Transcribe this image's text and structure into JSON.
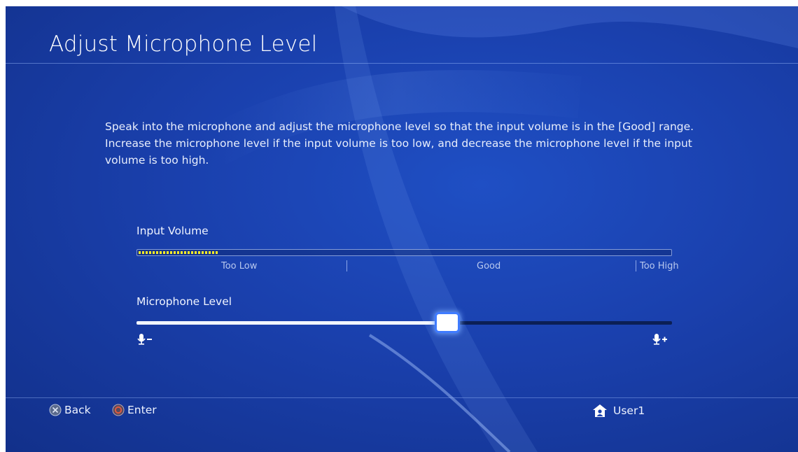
{
  "header": {
    "title": "Adjust Microphone Level"
  },
  "instructions": {
    "line1": "Speak into the microphone and adjust the microphone level so that the input volume is in the [Good] range.",
    "line2": "Increase the microphone level if the input volume is too low, and decrease the microphone level if the input volume is too high."
  },
  "input_volume": {
    "label": "Input Volume",
    "level_percent": 15,
    "ranges": {
      "too_low": "Too Low",
      "good": "Good",
      "too_high": "Too High"
    }
  },
  "microphone_level": {
    "label": "Microphone Level",
    "value_percent": 58
  },
  "footer": {
    "back_label": "Back",
    "enter_label": "Enter",
    "user_name": "User1"
  },
  "colors": {
    "background": "#1a40ad",
    "meter_fill": "#f5ea2a",
    "highlight": "#3f7bff",
    "enter_button": "#b83a2a"
  },
  "icons": {
    "back": "cross-button-icon",
    "enter": "circle-button-icon",
    "user": "home-icon",
    "mic_down": "mic-minus-icon",
    "mic_up": "mic-plus-icon"
  }
}
